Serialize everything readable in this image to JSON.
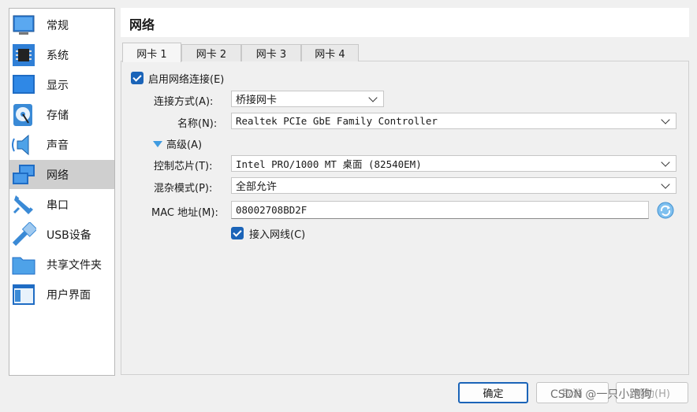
{
  "sidebar": {
    "items": [
      {
        "label": "常规",
        "icon": "general-icon"
      },
      {
        "label": "系统",
        "icon": "system-chip-icon"
      },
      {
        "label": "显示",
        "icon": "display-monitor-icon"
      },
      {
        "label": "存储",
        "icon": "storage-disk-icon"
      },
      {
        "label": "声音",
        "icon": "audio-speaker-icon"
      },
      {
        "label": "网络",
        "icon": "network-icon",
        "active": true
      },
      {
        "label": "串口",
        "icon": "serial-port-icon"
      },
      {
        "label": "USB设备",
        "icon": "usb-icon"
      },
      {
        "label": "共享文件夹",
        "icon": "shared-folder-icon"
      },
      {
        "label": "用户界面",
        "icon": "user-interface-icon"
      }
    ]
  },
  "header": {
    "title": "网络"
  },
  "tabs": [
    {
      "label": "网卡 1",
      "active": true
    },
    {
      "label": "网卡 2"
    },
    {
      "label": "网卡 3"
    },
    {
      "label": "网卡 4"
    }
  ],
  "form": {
    "enable_label": "启用网络连接(E)",
    "attached_label": "连接方式(A):",
    "attached_value": "桥接网卡",
    "name_label": "名称(N):",
    "name_value": "Realtek PCIe GbE Family Controller",
    "advanced_label": "高级(A)",
    "adapter_label": "控制芯片(T):",
    "adapter_value": "Intel PRO/1000 MT 桌面 (82540EM)",
    "promisc_label": "混杂模式(P):",
    "promisc_value": "全部允许",
    "mac_label": "MAC 地址(M):",
    "mac_value": "08002708BD2F",
    "cable_label": "接入网线(C)"
  },
  "buttons": {
    "ok": "确定",
    "cancel": "取消",
    "help": "帮助(H)"
  },
  "watermark": "CSDN @一只小跑狗",
  "colors": {
    "accent": "#1b64b8",
    "active_item": "#cfcfcf"
  }
}
